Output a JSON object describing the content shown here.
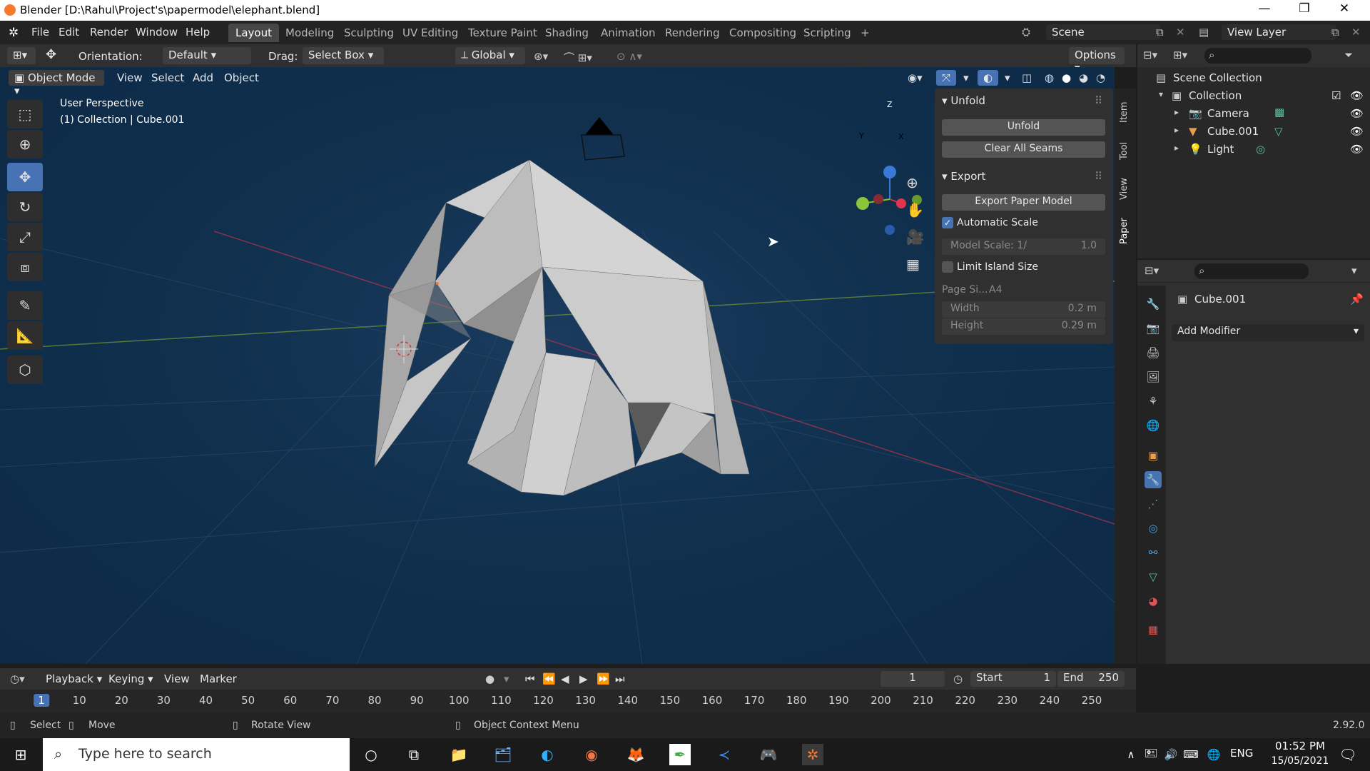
{
  "window": {
    "title": "Blender [D:\\Rahul\\Project's\\papermodel\\elephant.blend]",
    "controls": [
      "—",
      "❐",
      "✕"
    ]
  },
  "menu": {
    "items": [
      "File",
      "Edit",
      "Render",
      "Window",
      "Help"
    ],
    "workspaces": [
      "Layout",
      "Modeling",
      "Sculpting",
      "UV Editing",
      "Texture Paint",
      "Shading",
      "Animation",
      "Rendering",
      "Compositing",
      "Scripting"
    ],
    "add_tab": "+",
    "scene": "Scene",
    "view_layer": "View Layer"
  },
  "header3d": {
    "orientation_label": "Orientation:",
    "orientation_value": "Default",
    "drag_label": "Drag:",
    "drag_value": "Select Box",
    "transform": "Global",
    "options": "Options"
  },
  "viewport": {
    "mode": "Object Mode",
    "menus": [
      "View",
      "Select",
      "Add",
      "Object"
    ],
    "perspective": "User Perspective",
    "collection_info": "(1) Collection | Cube.001",
    "gizmo_labels": [
      "Z",
      "Y",
      "X"
    ]
  },
  "npanel": {
    "unfold_title": "Unfold",
    "unfold_button": "Unfold",
    "clear_seams_button": "Clear All Seams",
    "export_title": "Export",
    "export_button": "Export Paper Model",
    "automatic_scale": "Automatic Scale",
    "model_scale_label": "Model Scale: 1/",
    "model_scale_value": "1.0",
    "limit_island": "Limit Island Size",
    "page_size_label": "Page Si...",
    "page_size_value": "A4",
    "width_label": "Width",
    "width_value": "0.2 m",
    "height_label": "Height",
    "height_value": "0.29 m",
    "tabs": [
      "Item",
      "Tool",
      "View",
      "Paper"
    ]
  },
  "outliner": {
    "root": "Scene Collection",
    "collection": "Collection",
    "objects": [
      "Camera",
      "Cube.001",
      "Light"
    ]
  },
  "properties": {
    "object_name": "Cube.001",
    "add_modifier": "Add Modifier"
  },
  "timeline": {
    "menus": [
      "Playback",
      "Keying",
      "View",
      "Marker"
    ],
    "current_frame": "1",
    "start_label": "Start",
    "start_value": "1",
    "end_label": "End",
    "end_value": "250",
    "ticks": [
      "1",
      "10",
      "20",
      "30",
      "40",
      "50",
      "60",
      "70",
      "80",
      "90",
      "100",
      "110",
      "120",
      "130",
      "140",
      "150",
      "160",
      "170",
      "180",
      "190",
      "200",
      "210",
      "220",
      "230",
      "240",
      "250"
    ]
  },
  "statusbar": {
    "select": "Select",
    "move": "Move",
    "rotate": "Rotate View",
    "context": "Object Context Menu",
    "version": "2.92.0"
  },
  "taskbar": {
    "search_placeholder": "Type here to search",
    "time": "01:52 PM",
    "date": "15/05/2021",
    "lang": "ENG"
  }
}
